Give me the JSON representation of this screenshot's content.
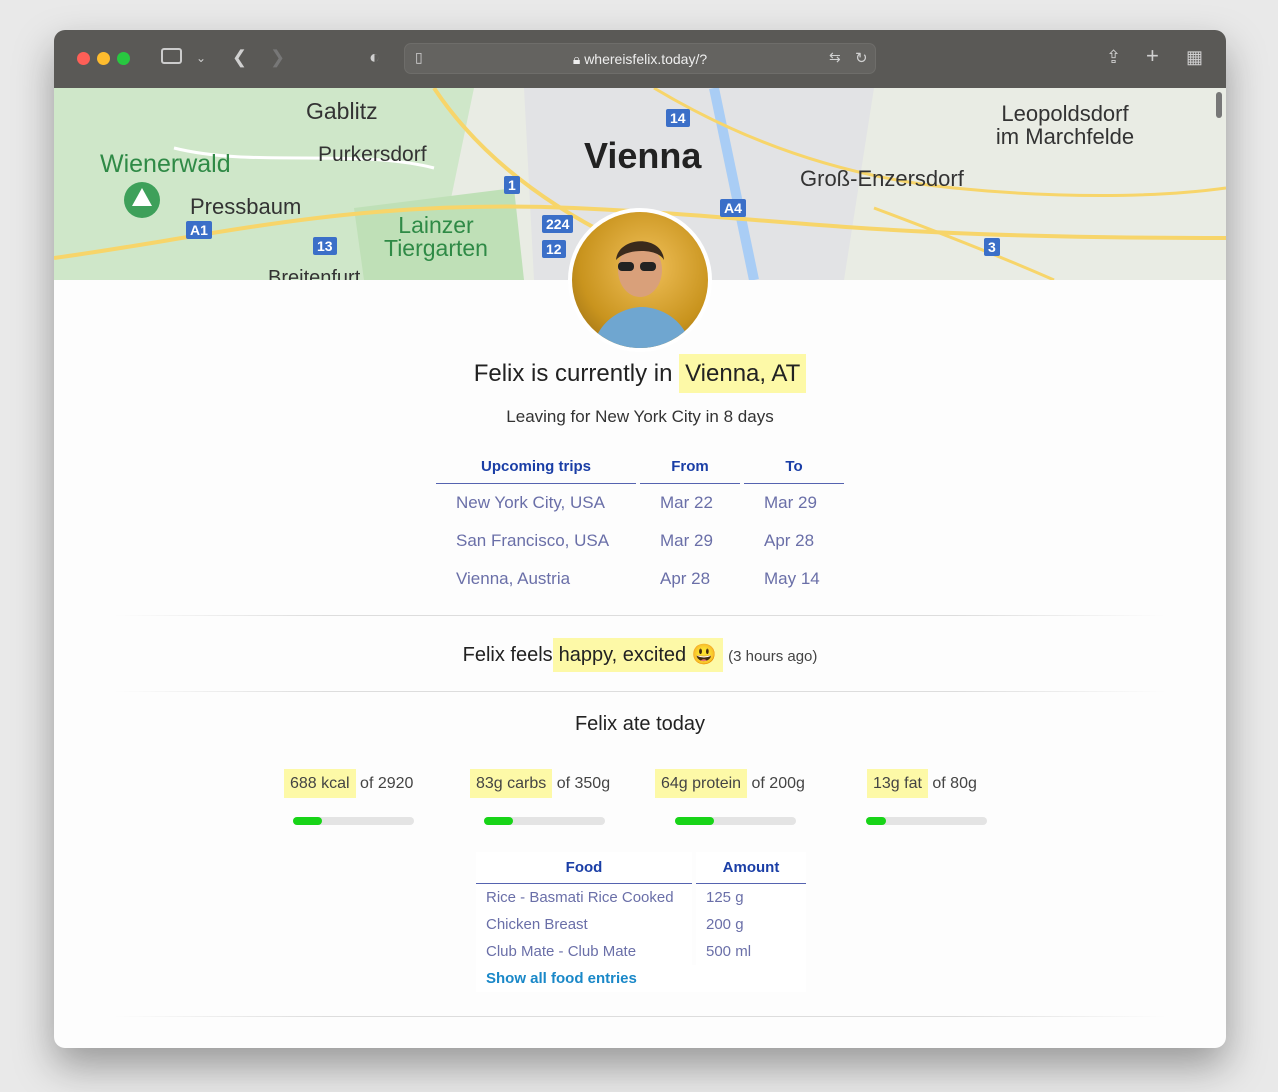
{
  "browser": {
    "url": "whereisfelix.today/?"
  },
  "map": {
    "labels": [
      "Gablitz",
      "Purkersdorf",
      "Wienerwald",
      "Pressbaum",
      "Lainzer Tiergarten",
      "Breitenfurt",
      "Vienna",
      "Leopoldsdorf im Marchfelde",
      "Groß-Enzersdorf"
    ],
    "shields": [
      "14",
      "1",
      "224",
      "12",
      "13",
      "A1",
      "A4",
      "3"
    ]
  },
  "status": {
    "prefix": "Felix is currently in",
    "location": "Vienna, AT",
    "leaving": "Leaving for New York City in 8 days"
  },
  "trips": {
    "headers": [
      "Upcoming trips",
      "From",
      "To"
    ],
    "rows": [
      [
        "New York City, USA",
        "Mar 22",
        "Mar 29"
      ],
      [
        "San Francisco, USA",
        "Mar 29",
        "Apr 28"
      ],
      [
        "Vienna, Austria",
        "Apr 28",
        "May 14"
      ]
    ]
  },
  "mood": {
    "prefix": "Felix feels",
    "value": "happy, excited",
    "emoji": "😃",
    "ago": "(3 hours ago)"
  },
  "food": {
    "title": "Felix ate today",
    "macros": [
      {
        "value": "688 kcal",
        "of": "of 2920",
        "progress": 0.236
      },
      {
        "value": "83g carbs",
        "of": "of 350g",
        "progress": 0.237
      },
      {
        "value": "64g protein",
        "of": "of 200g",
        "progress": 0.32
      },
      {
        "value": "13g fat",
        "of": "of 80g",
        "progress": 0.163
      }
    ],
    "headers": [
      "Food",
      "Amount"
    ],
    "rows": [
      [
        "Rice - Basmati Rice Cooked",
        "125 g"
      ],
      [
        "Chicken Breast",
        "200 g"
      ],
      [
        "Club Mate - Club Mate",
        "500 ml"
      ]
    ],
    "show_all": "Show all food entries"
  },
  "colors": {
    "highlight": "#fdf9a7",
    "progress": "#18d418",
    "header": "#1a3ea6"
  }
}
